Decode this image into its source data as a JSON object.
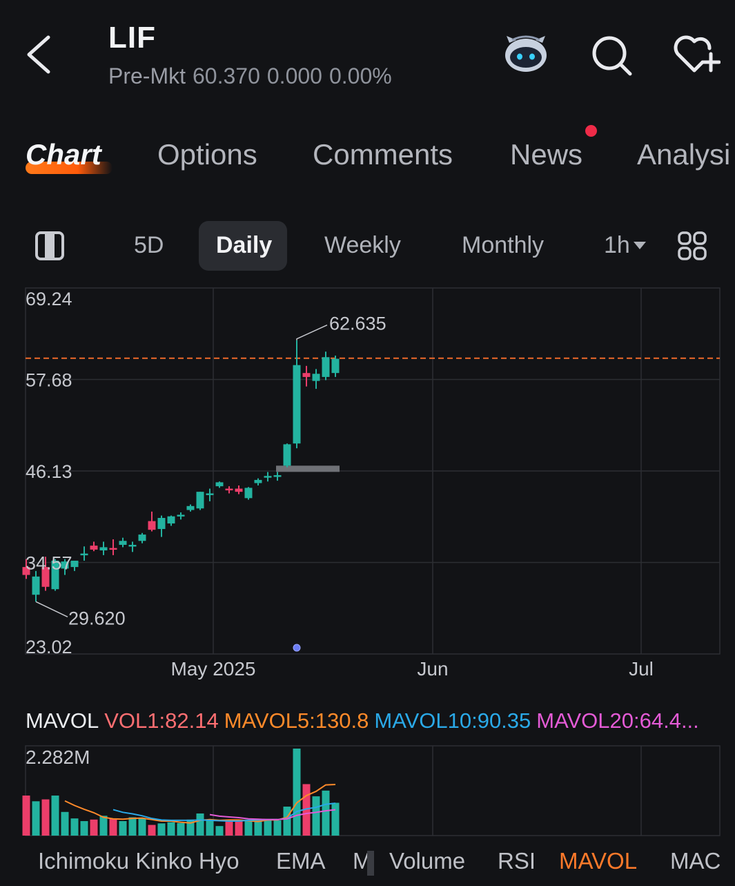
{
  "header": {
    "ticker": "LIF",
    "premarket_label": "Pre-Mkt",
    "premarket_price": "60.370",
    "premarket_change": "0.000",
    "premarket_change_pct": "0.00%"
  },
  "tabs": [
    {
      "label": "Chart",
      "active": true
    },
    {
      "label": "Options"
    },
    {
      "label": "Comments"
    },
    {
      "label": "News",
      "has_notification": true
    },
    {
      "label": "Analysi"
    }
  ],
  "periods": [
    "5D",
    "Daily",
    "Weekly",
    "Monthly",
    "1h"
  ],
  "active_period": "Daily",
  "icons": {
    "back": "chevron-left-icon",
    "assistant": "robot-icon",
    "search": "search-icon",
    "watchlist": "heart-plus-icon",
    "panel": "panel-layout-icon",
    "layout": "grid-icon"
  },
  "colors": {
    "up": "#23b3a0",
    "down": "#ec3e6a",
    "accent": "#ff7a1a",
    "ref_line": "#f06a2a"
  },
  "chart_data": [
    {
      "type": "candlestick",
      "y_ticks": [
        "69.24",
        "57.68",
        "46.13",
        "34.57",
        "23.02"
      ],
      "y_range": [
        23.02,
        69.24
      ],
      "x_ticks": [
        "May 2025",
        "Jun",
        "Jul"
      ],
      "high_label": "62.635",
      "low_label": "29.620",
      "reference_line": 60.37,
      "candles": [
        {
          "o": 34.0,
          "h": 35.0,
          "c": 33.0,
          "l": 32.5
        },
        {
          "o": 30.5,
          "h": 33.5,
          "c": 32.8,
          "l": 29.62
        },
        {
          "o": 34.0,
          "h": 35.3,
          "c": 31.5,
          "l": 31.0
        },
        {
          "o": 31.2,
          "h": 35.0,
          "c": 34.8,
          "l": 31.0
        },
        {
          "o": 33.8,
          "h": 35.0,
          "c": 34.7,
          "l": 33.0
        },
        {
          "o": 34.0,
          "h": 34.6,
          "c": 34.8,
          "l": 33.5
        },
        {
          "o": 35.5,
          "h": 36.6,
          "c": 35.7,
          "l": 34.8
        },
        {
          "o": 36.7,
          "h": 37.2,
          "c": 36.2,
          "l": 36.0
        },
        {
          "o": 36.1,
          "h": 37.2,
          "c": 36.5,
          "l": 35.5
        },
        {
          "o": 36.4,
          "h": 37.5,
          "c": 36.3,
          "l": 35.5
        },
        {
          "o": 36.8,
          "h": 37.7,
          "c": 37.3,
          "l": 36.5
        },
        {
          "o": 36.7,
          "h": 37.2,
          "c": 36.8,
          "l": 35.9
        },
        {
          "o": 37.3,
          "h": 38.3,
          "c": 38.1,
          "l": 37.0
        },
        {
          "o": 39.8,
          "h": 41.0,
          "c": 38.7,
          "l": 38.5
        },
        {
          "o": 38.8,
          "h": 40.5,
          "c": 40.2,
          "l": 37.8
        },
        {
          "o": 39.5,
          "h": 40.5,
          "c": 40.4,
          "l": 39.2
        },
        {
          "o": 40.5,
          "h": 40.9,
          "c": 40.6,
          "l": 40.0
        },
        {
          "o": 41.2,
          "h": 41.9,
          "c": 41.7,
          "l": 41.0
        },
        {
          "o": 41.4,
          "h": 43.5,
          "c": 43.5,
          "l": 41.2
        },
        {
          "o": 43.3,
          "h": 43.9,
          "c": 43.3,
          "l": 42.3
        },
        {
          "o": 44.2,
          "h": 44.8,
          "c": 44.7,
          "l": 44.0
        },
        {
          "o": 43.9,
          "h": 44.2,
          "c": 43.8,
          "l": 43.3
        },
        {
          "o": 43.9,
          "h": 44.3,
          "c": 43.5,
          "l": 43.2
        },
        {
          "o": 42.7,
          "h": 44.1,
          "c": 44.0,
          "l": 42.5
        },
        {
          "o": 44.6,
          "h": 45.2,
          "c": 45.0,
          "l": 44.3
        },
        {
          "o": 45.4,
          "h": 46.0,
          "c": 45.5,
          "l": 44.8
        },
        {
          "o": 45.4,
          "h": 46.0,
          "c": 45.6,
          "l": 44.9
        },
        {
          "o": 46.8,
          "h": 49.6,
          "c": 49.5,
          "l": 46.6
        },
        {
          "o": 49.6,
          "h": 62.635,
          "c": 59.5,
          "l": 49.0
        },
        {
          "o": 58.5,
          "h": 59.4,
          "c": 58.0,
          "l": 56.8
        },
        {
          "o": 57.5,
          "h": 59.0,
          "c": 58.4,
          "l": 56.5
        },
        {
          "o": 58.0,
          "h": 61.2,
          "c": 60.5,
          "l": 57.6
        },
        {
          "o": 58.5,
          "h": 60.7,
          "c": 60.3,
          "l": 58.0
        }
      ]
    },
    {
      "type": "bar",
      "title": "MAVOL",
      "legend": [
        {
          "label": "VOL1:82.14",
          "color": "#ff6f72"
        },
        {
          "label": "MAVOL5:130.8",
          "color": "#ff8a2a"
        },
        {
          "label": "MAVOL10:90.35",
          "color": "#2aa9e8"
        },
        {
          "label": "MAVOL20:64.4...",
          "color": "#e45bd6"
        }
      ],
      "max_label": "2.282M",
      "y_range": [
        0,
        2.282
      ],
      "volumes": [
        1.05,
        0.9,
        0.95,
        1.05,
        0.62,
        0.45,
        0.38,
        0.42,
        0.52,
        0.45,
        0.38,
        0.48,
        0.45,
        0.28,
        0.32,
        0.35,
        0.33,
        0.42,
        0.58,
        0.42,
        0.25,
        0.38,
        0.41,
        0.42,
        0.41,
        0.42,
        0.4,
        0.76,
        2.282,
        1.35,
        1.03,
        1.18,
        0.86
      ],
      "mavol5": [
        null,
        null,
        null,
        null,
        0.91,
        0.79,
        0.69,
        0.6,
        0.48,
        0.44,
        0.43,
        0.45,
        0.46,
        0.42,
        0.38,
        0.38,
        0.35,
        0.33,
        0.4,
        0.42,
        0.4,
        0.41,
        0.41,
        0.39,
        0.37,
        0.41,
        0.41,
        0.48,
        0.86,
        1.05,
        1.16,
        1.33,
        1.34
      ],
      "mavol10": [
        null,
        null,
        null,
        null,
        null,
        null,
        null,
        null,
        null,
        0.68,
        0.61,
        0.57,
        0.52,
        0.45,
        0.41,
        0.4,
        0.4,
        0.4,
        0.41,
        0.4,
        0.39,
        0.38,
        0.38,
        0.4,
        0.41,
        0.42,
        0.42,
        0.45,
        0.63,
        0.7,
        0.74,
        0.82,
        0.85
      ],
      "mavol20": [
        null,
        null,
        null,
        null,
        null,
        null,
        null,
        null,
        null,
        null,
        null,
        null,
        null,
        null,
        null,
        null,
        null,
        null,
        null,
        0.55,
        0.51,
        0.49,
        0.47,
        0.44,
        0.43,
        0.42,
        0.42,
        0.44,
        0.53,
        0.58,
        0.61,
        0.65,
        0.68
      ]
    }
  ],
  "indicators": [
    "Ichimoku Kinko Hyo",
    "EMA",
    "M",
    "Volume",
    "RSI",
    "MAVOL",
    "MAC"
  ],
  "active_indicator": "MAVOL"
}
